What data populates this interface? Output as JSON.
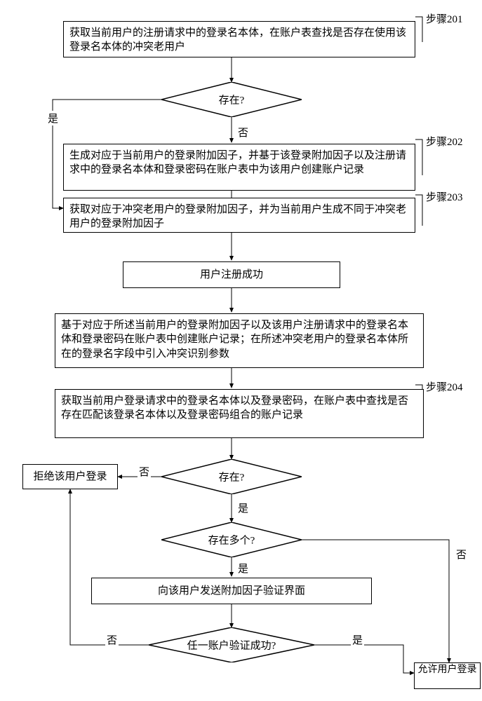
{
  "steps": {
    "s201": "步骤201",
    "s202": "步骤202",
    "s203": "步骤203",
    "s204": "步骤204"
  },
  "nodes": {
    "n1": "获取当前用户的注册请求中的登录名本体，在账户表查找是否存在使用该登录名本体的冲突老用户",
    "d1": "存在?",
    "n2": "生成对应于当前用户的登录附加因子，并基于该登录附加因子以及注册请求中的登录名本体和登录密码在账户表中为该用户创建账户记录",
    "n3": "获取对应于冲突老用户的登录附加因子，并为当前用户生成不同于冲突老用户的登录附加因子",
    "n4": "用户注册成功",
    "n5": "基于对应于所述当前用户的登录附加因子以及该用户注册请求中的登录名本体和登录密码在账户表中创建账户记录；在所述冲突老用户的登录名本体所在的登录名字段中引入冲突识别参数",
    "n6": "获取当前用户登录请求中的登录名本体以及登录密码，在账户表中查找是否存在匹配该登录名本体以及登录密码组合的账户记录",
    "d2": "存在?",
    "d3": "存在多个?",
    "n7": "向该用户发送附加因子验证界面",
    "d4": "任一账户验证成功?",
    "reject": "拒绝该用户登录",
    "allow": "允许用户登录"
  },
  "labels": {
    "yes": "是",
    "no": "否"
  }
}
